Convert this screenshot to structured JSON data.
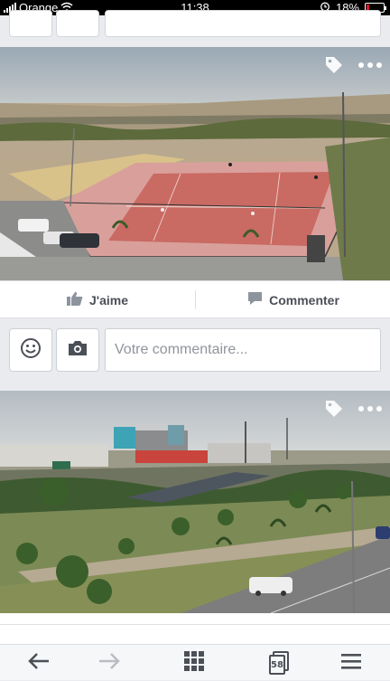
{
  "status_bar": {
    "carrier": "Orange",
    "time": "11:38",
    "battery": "18%",
    "battery_level": 0.18
  },
  "posts": [
    {
      "actions": {
        "like_label": "J'aime",
        "comment_label": "Commenter"
      },
      "comment": {
        "placeholder": "Votre commentaire..."
      }
    },
    {}
  ],
  "bottom_nav": {
    "tabs_count": "58"
  },
  "icons": {
    "like": "thumbs-up-icon",
    "comment": "speech-bubble-icon",
    "emoji": "smiley-icon",
    "camera": "camera-icon",
    "tag": "tag-icon",
    "more": "more-icon",
    "back": "back-arrow-icon",
    "forward": "forward-arrow-icon",
    "apps": "grid-icon",
    "tabs": "tabs-icon",
    "menu": "hamburger-menu-icon"
  },
  "colors": {
    "battery_low": "#e0142b",
    "text_muted": "#4b4f56",
    "placeholder": "#90949c"
  }
}
